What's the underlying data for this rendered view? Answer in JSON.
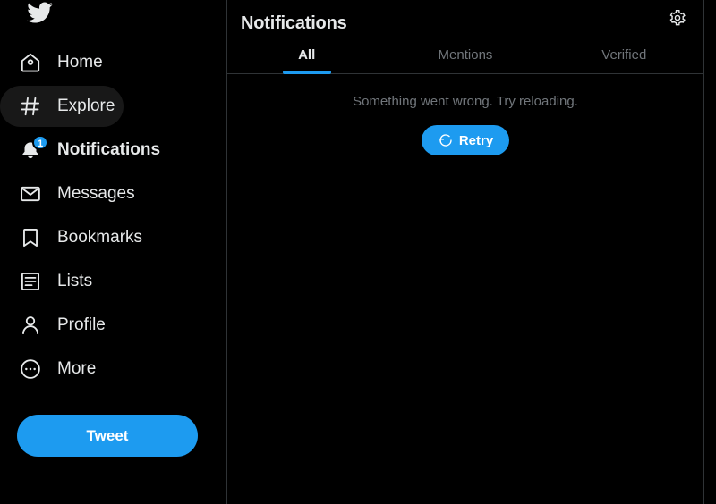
{
  "theme": {
    "background": "#000000",
    "accent": "#1d9bf0",
    "text_primary": "#e7e9ea",
    "text_muted": "#71767b",
    "divider": "#2f3336",
    "hover_fill": "#181818"
  },
  "sidebar": {
    "logo_icon": "twitter-bird-icon",
    "items": [
      {
        "label": "Home",
        "icon": "home-icon",
        "active": false,
        "hover": false,
        "badge": null
      },
      {
        "label": "Explore",
        "icon": "hashtag-icon",
        "active": false,
        "hover": true,
        "badge": null
      },
      {
        "label": "Notifications",
        "icon": "bell-icon",
        "active": true,
        "hover": false,
        "badge": "1"
      },
      {
        "label": "Messages",
        "icon": "envelope-icon",
        "active": false,
        "hover": false,
        "badge": null
      },
      {
        "label": "Bookmarks",
        "icon": "bookmark-icon",
        "active": false,
        "hover": false,
        "badge": null
      },
      {
        "label": "Lists",
        "icon": "list-icon",
        "active": false,
        "hover": false,
        "badge": null
      },
      {
        "label": "Profile",
        "icon": "person-icon",
        "active": false,
        "hover": false,
        "badge": null
      },
      {
        "label": "More",
        "icon": "more-circle-icon",
        "active": false,
        "hover": false,
        "badge": null
      }
    ],
    "compose": {
      "label": "Tweet"
    }
  },
  "main": {
    "header": {
      "title": "Notifications",
      "settings_icon": "gear-icon"
    },
    "tabs": [
      {
        "label": "All",
        "active": true
      },
      {
        "label": "Mentions",
        "active": false
      },
      {
        "label": "Verified",
        "active": false
      }
    ],
    "error": {
      "message": "Something went wrong. Try reloading.",
      "retry_label": "Retry",
      "retry_icon": "refresh-icon"
    }
  }
}
